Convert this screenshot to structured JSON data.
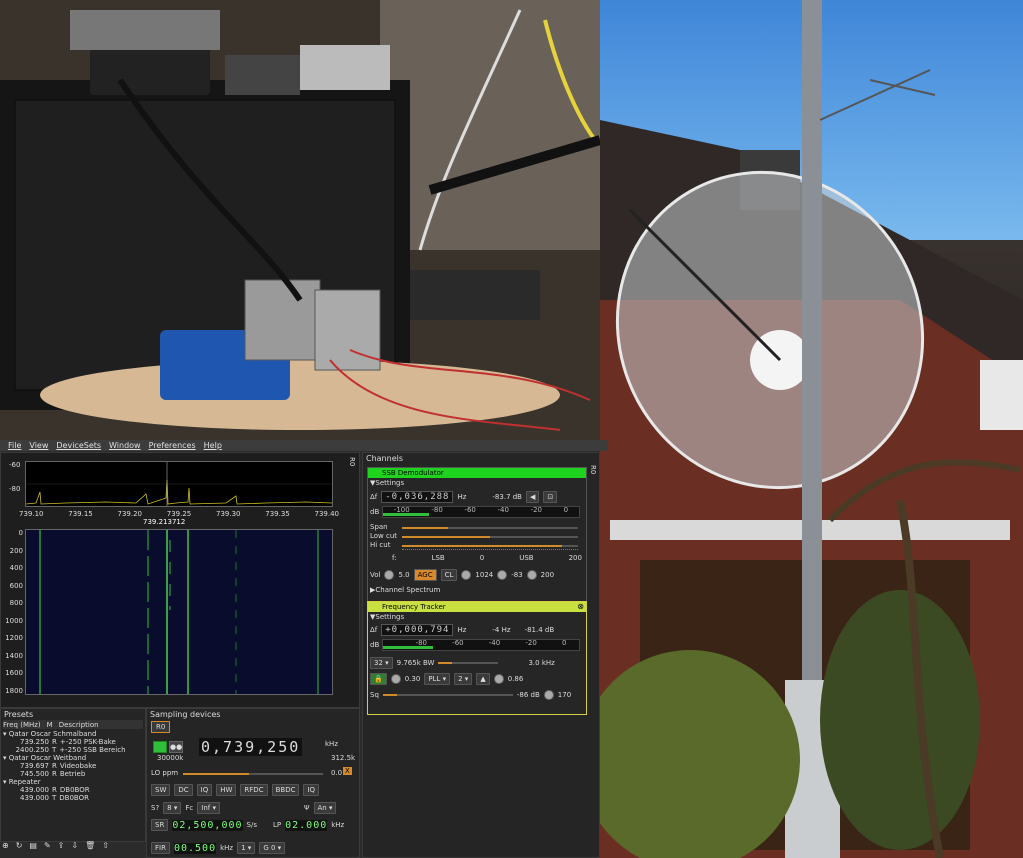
{
  "menubar": [
    "File",
    "View",
    "DeviceSets",
    "Window",
    "Preferences",
    "Help"
  ],
  "spectrum": {
    "y_ticks": [
      "-60",
      "-80"
    ],
    "x_ticks": [
      "739.10",
      "739.15",
      "739.20",
      "739.25",
      "739.30",
      "739.35",
      "739.40"
    ],
    "marker": "739.213712",
    "waterfall_ticks": [
      "0",
      "200",
      "400",
      "600",
      "800",
      "1000",
      "1200",
      "1400",
      "1600",
      "1800"
    ],
    "side_label": "R0"
  },
  "channels": {
    "title": "Channels",
    "ssb": {
      "header": "SSB Demodulator",
      "settings": "Settings",
      "delta_label": "Δf",
      "freq": "-0,036,288",
      "unit": "Hz",
      "db_value": "-83.7 dB",
      "scale_label": "dB",
      "scale_ticks": [
        "-100",
        "-80",
        "-60",
        "-40",
        "-20",
        "0"
      ],
      "span_label": "Span",
      "lowcut_label": "Low cut",
      "hicut_label": "Hi cut",
      "fft_label": "f:",
      "band_labels": [
        "LSB",
        "0",
        "USB"
      ],
      "hicut_value": "200",
      "vol_label": "Vol",
      "vol_value": "5.0",
      "agc": "AGC",
      "cl": "CL",
      "agc_value": "1024",
      "agc_threshold": "-83",
      "agc_delay": "200",
      "channel_spectrum": "Channel Spectrum"
    },
    "tracker": {
      "header": "Frequency Tracker",
      "settings": "Settings",
      "delta_label": "Δf",
      "freq": "+0,000,794",
      "unit": "Hz",
      "offset": "-4 Hz",
      "db_value": "-81.4 dB",
      "scale_label": "dB",
      "scale_ticks": [
        "-80",
        "-60",
        "-40",
        "-20",
        "0"
      ],
      "decim": "32",
      "bw": "9.765k BW",
      "rrc": "3.0 kHz",
      "alpha": "0.30",
      "pll": "PLL",
      "order": "2",
      "tau": "0.86",
      "sq_label": "Sq",
      "sq_value": "-86 dB",
      "sq_gate": "170"
    },
    "side_label": "R0"
  },
  "presets": {
    "title": "Presets",
    "columns": [
      "Freq (MHz)",
      "M",
      "Description"
    ],
    "rows": [
      {
        "indent": 0,
        "text": "Qatar Oscar Schmalband"
      },
      {
        "indent": 1,
        "freq": "739.250",
        "mode": "R",
        "desc": "+-250 PSK-Bake"
      },
      {
        "indent": 1,
        "freq": "2400.250",
        "mode": "T",
        "desc": "+-250 SSB Bereich"
      },
      {
        "indent": 0,
        "text": "Qatar Oscar Weitband"
      },
      {
        "indent": 1,
        "freq": "739.697",
        "mode": "R",
        "desc": "Videobake"
      },
      {
        "indent": 1,
        "freq": "745.500",
        "mode": "R",
        "desc": "Betrieb"
      },
      {
        "indent": 0,
        "text": "Repeater"
      },
      {
        "indent": 1,
        "freq": "439.000",
        "mode": "R",
        "desc": "DB0BOR"
      },
      {
        "indent": 1,
        "freq": "439.000",
        "mode": "T",
        "desc": "DB0BOR"
      }
    ]
  },
  "sampling": {
    "title": "Sampling devices",
    "tab": "R0",
    "center_freq": "0,739,250",
    "freq_unit": "kHz",
    "sample_rate_top": "30000k",
    "bw_display": "312.5k",
    "lo_ppm_label": "LO ppm",
    "lo_ppm_value": "0.0",
    "x": "X",
    "toggles": [
      "SW",
      "DC",
      "IQ",
      "HW",
      "RFDC",
      "BBDC",
      "IQ"
    ],
    "s_label": "S?",
    "s_value": "8",
    "fc_label": "Fc",
    "fc_value": "Inf",
    "ant": "An",
    "sr_label": "SR",
    "sr_value": "02,500,000",
    "sr_unit": "S/s",
    "lp_label": "LP",
    "lp_value": "02.000",
    "lp_unit": "kHz",
    "fir_label": "FIR",
    "fir_value": "00.500",
    "fir_unit": "kHz",
    "fir_order": "1",
    "fir_gain": "G 0"
  }
}
